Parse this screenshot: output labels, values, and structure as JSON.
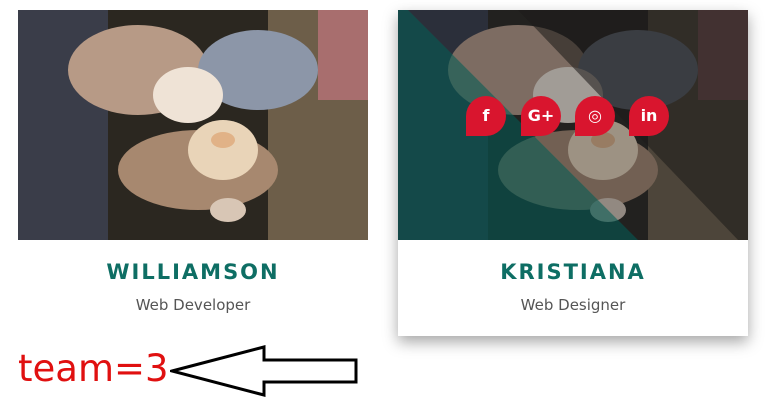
{
  "members": [
    {
      "name": "WILLIAMSON",
      "role": "Web Developer"
    },
    {
      "name": "KRISTIANA",
      "role": "Web Designer"
    }
  ],
  "socials": [
    {
      "label": "f",
      "icon": "facebook-icon"
    },
    {
      "label": "G+",
      "icon": "google-plus-icon"
    },
    {
      "label": "◎",
      "icon": "instagram-icon"
    },
    {
      "label": "in",
      "icon": "linkedin-icon"
    }
  ],
  "annotation": {
    "text": "team=3"
  },
  "colors": {
    "accent_teal": "#0e6e64",
    "social_red": "#d9152e",
    "annotation_red": "#e01010"
  }
}
